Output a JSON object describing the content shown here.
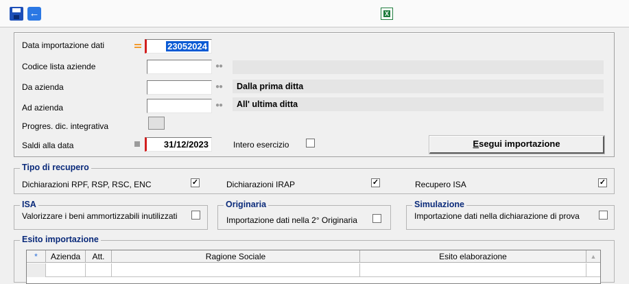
{
  "toolbar": {
    "save_icon": "save-icon",
    "back_icon": "back-arrow-icon",
    "excel_icon": "excel-export-icon"
  },
  "form": {
    "data_importazione": {
      "label": "Data importazione dati",
      "value": "23052024"
    },
    "codice_lista": {
      "label": "Codice lista aziende",
      "value": "",
      "description": ""
    },
    "da_azienda": {
      "label": "Da azienda",
      "value": "",
      "description": "Dalla prima ditta"
    },
    "ad_azienda": {
      "label": "Ad azienda",
      "value": "",
      "description": "All' ultima ditta"
    },
    "progres": {
      "label": "Progres. dic. integrativa"
    },
    "saldi": {
      "label": "Saldi alla data",
      "value": "31/12/2023"
    },
    "intero_esercizio": {
      "label": "Intero esercizio",
      "checked": false
    },
    "esegui_button": {
      "label_underlined": "E",
      "label_rest": "segui importazione"
    }
  },
  "tipo_recupero": {
    "title": "Tipo di recupero",
    "items": [
      {
        "label": "Dichiarazioni RPF, RSP, RSC, ENC",
        "checked": true,
        "mark": "✓"
      },
      {
        "label": "Dichiarazioni IRAP",
        "checked": true,
        "mark": "✓"
      },
      {
        "label": "Recupero ISA",
        "checked": true,
        "mark": "✓"
      }
    ]
  },
  "isa": {
    "title": "ISA",
    "label": "Valorizzare i beni ammortizzabili inutilizzati",
    "checked": false
  },
  "originaria": {
    "title": "Originaria",
    "label": "Importazione dati nella 2° Originaria",
    "checked": false
  },
  "simulazione": {
    "title": "Simulazione",
    "label": "Importazione dati nella dichiarazione di prova",
    "checked": false
  },
  "esito": {
    "title": "Esito importazione",
    "columns": [
      "*",
      "Azienda",
      "Att.",
      "Ragione Sociale",
      "Esito elaborazione"
    ],
    "rows": [
      [
        "",
        "",
        "",
        "",
        ""
      ]
    ]
  },
  "colors": {
    "group_title": "#0a2a7a",
    "required_marker": "#d21e1e",
    "selection": "#0a5ad4"
  }
}
